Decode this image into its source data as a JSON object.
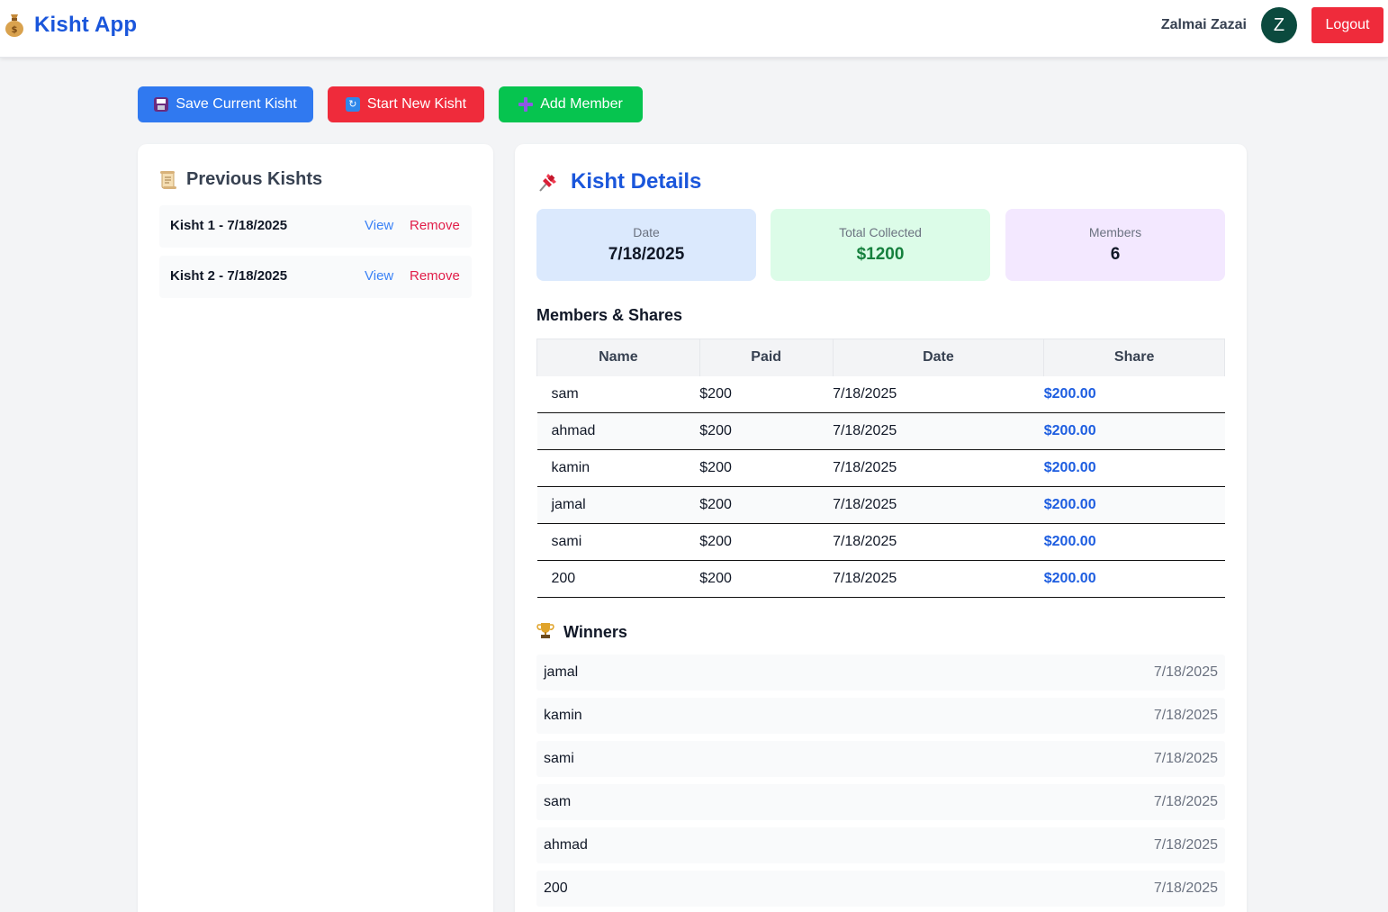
{
  "header": {
    "app_title": "Kisht App",
    "brand_icon": "money-bag-icon",
    "user_name": "Zalmai Zazai",
    "avatar_letter": "Z",
    "logout_label": "Logout"
  },
  "actions": {
    "save_label": "Save Current Kisht",
    "new_label": "Start New Kisht",
    "add_label": "Add Member"
  },
  "previous": {
    "title": "Previous Kishts",
    "items": [
      {
        "label": "Kisht 1 - 7/18/2025",
        "view": "View",
        "remove": "Remove"
      },
      {
        "label": "Kisht 2 - 7/18/2025",
        "view": "View",
        "remove": "Remove"
      }
    ]
  },
  "details": {
    "title": "Kisht Details",
    "stats": {
      "date_label": "Date",
      "date_value": "7/18/2025",
      "total_label": "Total Collected",
      "total_value": "$1200",
      "members_label": "Members",
      "members_value": "6"
    },
    "members_heading": "Members & Shares",
    "columns": [
      "Name",
      "Paid",
      "Date",
      "Share"
    ],
    "rows": [
      {
        "name": "sam",
        "paid": "$200",
        "date": "7/18/2025",
        "share": "$200.00"
      },
      {
        "name": "ahmad",
        "paid": "$200",
        "date": "7/18/2025",
        "share": "$200.00"
      },
      {
        "name": "kamin",
        "paid": "$200",
        "date": "7/18/2025",
        "share": "$200.00"
      },
      {
        "name": "jamal",
        "paid": "$200",
        "date": "7/18/2025",
        "share": "$200.00"
      },
      {
        "name": "sami",
        "paid": "$200",
        "date": "7/18/2025",
        "share": "$200.00"
      },
      {
        "name": "200",
        "paid": "$200",
        "date": "7/18/2025",
        "share": "$200.00"
      }
    ],
    "winners_heading": "Winners",
    "winners": [
      {
        "name": "jamal",
        "date": "7/18/2025"
      },
      {
        "name": "kamin",
        "date": "7/18/2025"
      },
      {
        "name": "sami",
        "date": "7/18/2025"
      },
      {
        "name": "sam",
        "date": "7/18/2025"
      },
      {
        "name": "ahmad",
        "date": "7/18/2025"
      },
      {
        "name": "200",
        "date": "7/18/2025"
      }
    ]
  }
}
